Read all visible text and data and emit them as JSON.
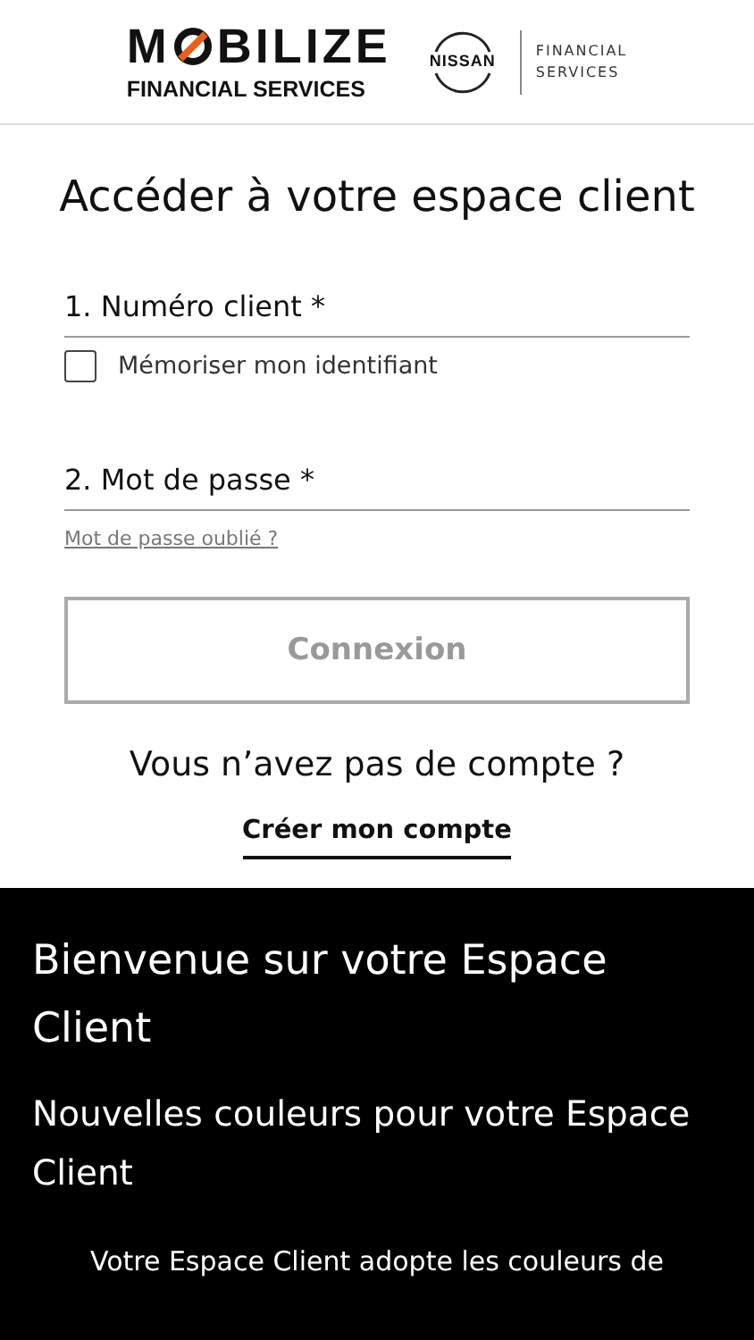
{
  "header": {
    "logo_start": "M",
    "logo_end": "BILIZE",
    "logo_sub": "FINANCIAL SERVICES",
    "partner": "NISSAN",
    "partner_sub": [
      "FINANCIAL",
      "SERVICES"
    ]
  },
  "login": {
    "title": "Accéder à votre espace client",
    "fields": [
      {
        "label": "1. Numéro client *"
      },
      {
        "label": "2. Mot de passe *"
      }
    ],
    "remember": {
      "label": "Mémoriser mon identifiant",
      "checked": false
    },
    "forgot_link": "Mot de passe oublié ?",
    "submit": {
      "label": "Connexion",
      "disabled": true
    },
    "no_account": "Vous n’avez pas de compte ?",
    "create_link": "Créer mon compte"
  },
  "welcome": {
    "title": "Bienvenue sur votre Espace Client",
    "subtitle": "Nouvelles couleurs pour votre Espace Client",
    "text": "Votre Espace Client adopte les couleurs de"
  }
}
